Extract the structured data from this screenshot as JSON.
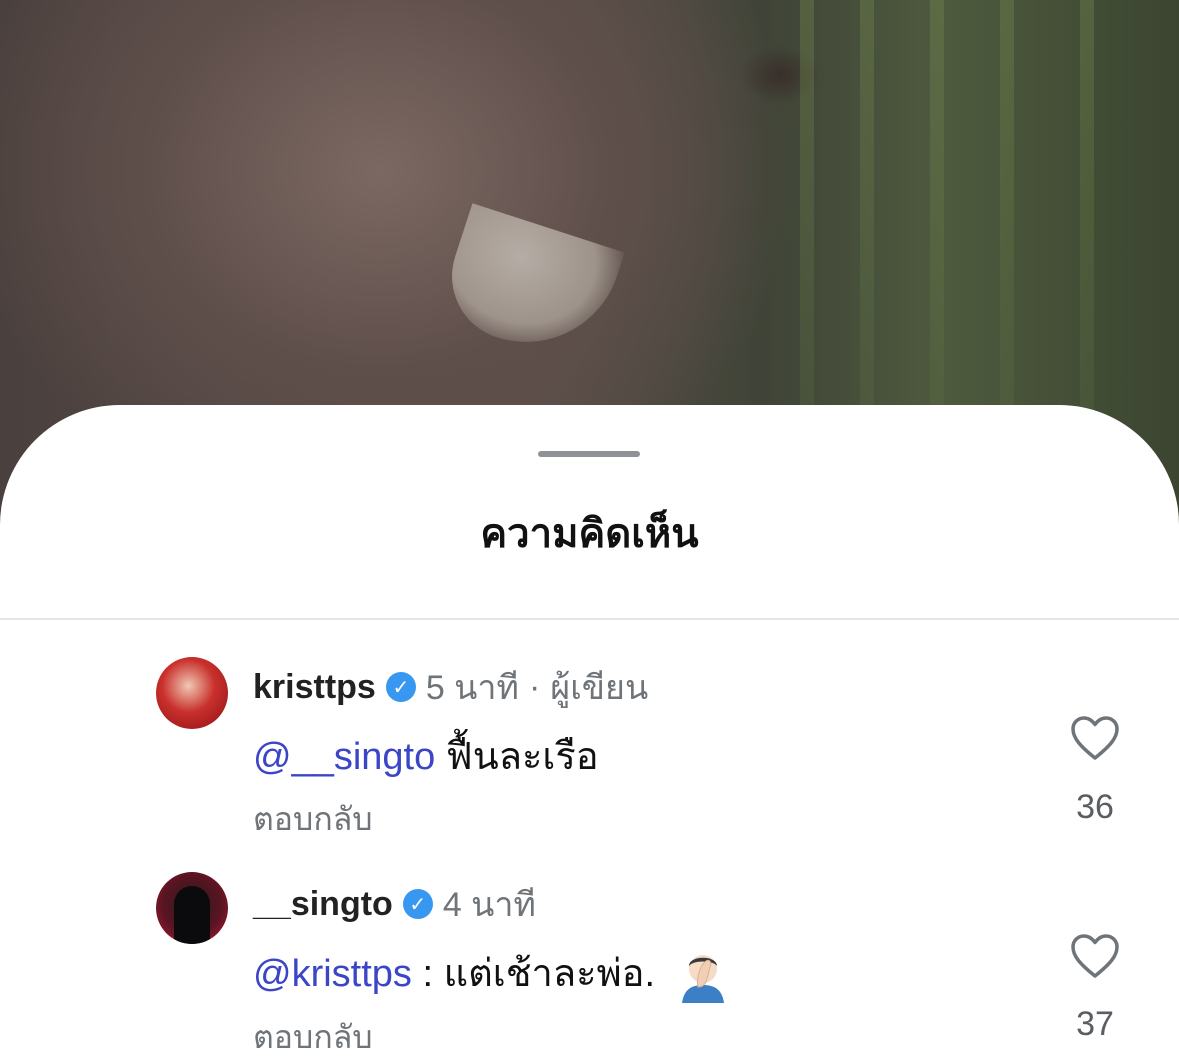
{
  "sheet": {
    "title": "ความคิดเห็น"
  },
  "comments": [
    {
      "username": "kristtps",
      "verified": true,
      "time": "5 นาที",
      "separator": "·",
      "author_tag": "ผู้เขียน",
      "mention": "@__singto",
      "text": " ฟื้นละเรือ",
      "reply_label": "ตอบกลับ",
      "likes": "36"
    },
    {
      "username": "__singto",
      "verified": true,
      "time": "4 นาที",
      "mention": "@kristtps",
      "text": " : แต่เช้าละพ่อ.",
      "emoji": "facepalm",
      "reply_label": "ตอบกลับ",
      "likes": "37"
    }
  ],
  "colors": {
    "mention": "#3b46c7",
    "verified": "#3897f0",
    "muted": "#6f7479"
  }
}
